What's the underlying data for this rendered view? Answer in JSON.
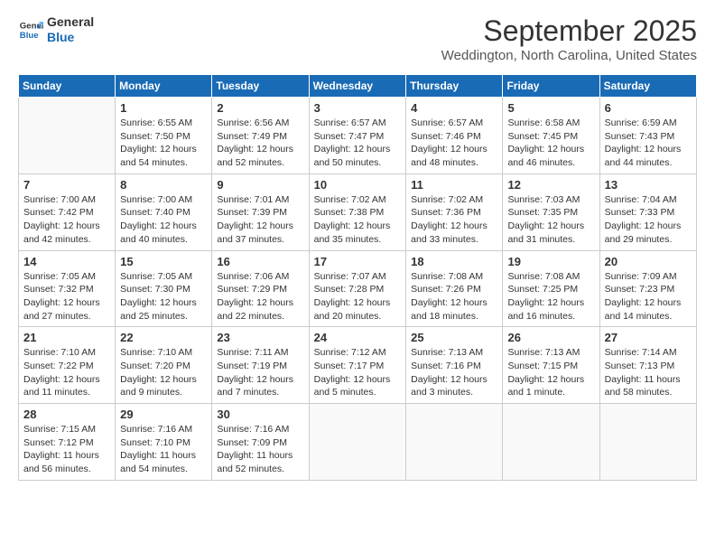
{
  "logo": {
    "line1": "General",
    "line2": "Blue"
  },
  "title": "September 2025",
  "location": "Weddington, North Carolina, United States",
  "days_header": [
    "Sunday",
    "Monday",
    "Tuesday",
    "Wednesday",
    "Thursday",
    "Friday",
    "Saturday"
  ],
  "weeks": [
    [
      {
        "day": "",
        "info": ""
      },
      {
        "day": "1",
        "info": "Sunrise: 6:55 AM\nSunset: 7:50 PM\nDaylight: 12 hours\nand 54 minutes."
      },
      {
        "day": "2",
        "info": "Sunrise: 6:56 AM\nSunset: 7:49 PM\nDaylight: 12 hours\nand 52 minutes."
      },
      {
        "day": "3",
        "info": "Sunrise: 6:57 AM\nSunset: 7:47 PM\nDaylight: 12 hours\nand 50 minutes."
      },
      {
        "day": "4",
        "info": "Sunrise: 6:57 AM\nSunset: 7:46 PM\nDaylight: 12 hours\nand 48 minutes."
      },
      {
        "day": "5",
        "info": "Sunrise: 6:58 AM\nSunset: 7:45 PM\nDaylight: 12 hours\nand 46 minutes."
      },
      {
        "day": "6",
        "info": "Sunrise: 6:59 AM\nSunset: 7:43 PM\nDaylight: 12 hours\nand 44 minutes."
      }
    ],
    [
      {
        "day": "7",
        "info": "Sunrise: 7:00 AM\nSunset: 7:42 PM\nDaylight: 12 hours\nand 42 minutes."
      },
      {
        "day": "8",
        "info": "Sunrise: 7:00 AM\nSunset: 7:40 PM\nDaylight: 12 hours\nand 40 minutes."
      },
      {
        "day": "9",
        "info": "Sunrise: 7:01 AM\nSunset: 7:39 PM\nDaylight: 12 hours\nand 37 minutes."
      },
      {
        "day": "10",
        "info": "Sunrise: 7:02 AM\nSunset: 7:38 PM\nDaylight: 12 hours\nand 35 minutes."
      },
      {
        "day": "11",
        "info": "Sunrise: 7:02 AM\nSunset: 7:36 PM\nDaylight: 12 hours\nand 33 minutes."
      },
      {
        "day": "12",
        "info": "Sunrise: 7:03 AM\nSunset: 7:35 PM\nDaylight: 12 hours\nand 31 minutes."
      },
      {
        "day": "13",
        "info": "Sunrise: 7:04 AM\nSunset: 7:33 PM\nDaylight: 12 hours\nand 29 minutes."
      }
    ],
    [
      {
        "day": "14",
        "info": "Sunrise: 7:05 AM\nSunset: 7:32 PM\nDaylight: 12 hours\nand 27 minutes."
      },
      {
        "day": "15",
        "info": "Sunrise: 7:05 AM\nSunset: 7:30 PM\nDaylight: 12 hours\nand 25 minutes."
      },
      {
        "day": "16",
        "info": "Sunrise: 7:06 AM\nSunset: 7:29 PM\nDaylight: 12 hours\nand 22 minutes."
      },
      {
        "day": "17",
        "info": "Sunrise: 7:07 AM\nSunset: 7:28 PM\nDaylight: 12 hours\nand 20 minutes."
      },
      {
        "day": "18",
        "info": "Sunrise: 7:08 AM\nSunset: 7:26 PM\nDaylight: 12 hours\nand 18 minutes."
      },
      {
        "day": "19",
        "info": "Sunrise: 7:08 AM\nSunset: 7:25 PM\nDaylight: 12 hours\nand 16 minutes."
      },
      {
        "day": "20",
        "info": "Sunrise: 7:09 AM\nSunset: 7:23 PM\nDaylight: 12 hours\nand 14 minutes."
      }
    ],
    [
      {
        "day": "21",
        "info": "Sunrise: 7:10 AM\nSunset: 7:22 PM\nDaylight: 12 hours\nand 11 minutes."
      },
      {
        "day": "22",
        "info": "Sunrise: 7:10 AM\nSunset: 7:20 PM\nDaylight: 12 hours\nand 9 minutes."
      },
      {
        "day": "23",
        "info": "Sunrise: 7:11 AM\nSunset: 7:19 PM\nDaylight: 12 hours\nand 7 minutes."
      },
      {
        "day": "24",
        "info": "Sunrise: 7:12 AM\nSunset: 7:17 PM\nDaylight: 12 hours\nand 5 minutes."
      },
      {
        "day": "25",
        "info": "Sunrise: 7:13 AM\nSunset: 7:16 PM\nDaylight: 12 hours\nand 3 minutes."
      },
      {
        "day": "26",
        "info": "Sunrise: 7:13 AM\nSunset: 7:15 PM\nDaylight: 12 hours\nand 1 minute."
      },
      {
        "day": "27",
        "info": "Sunrise: 7:14 AM\nSunset: 7:13 PM\nDaylight: 11 hours\nand 58 minutes."
      }
    ],
    [
      {
        "day": "28",
        "info": "Sunrise: 7:15 AM\nSunset: 7:12 PM\nDaylight: 11 hours\nand 56 minutes."
      },
      {
        "day": "29",
        "info": "Sunrise: 7:16 AM\nSunset: 7:10 PM\nDaylight: 11 hours\nand 54 minutes."
      },
      {
        "day": "30",
        "info": "Sunrise: 7:16 AM\nSunset: 7:09 PM\nDaylight: 11 hours\nand 52 minutes."
      },
      {
        "day": "",
        "info": ""
      },
      {
        "day": "",
        "info": ""
      },
      {
        "day": "",
        "info": ""
      },
      {
        "day": "",
        "info": ""
      }
    ]
  ]
}
